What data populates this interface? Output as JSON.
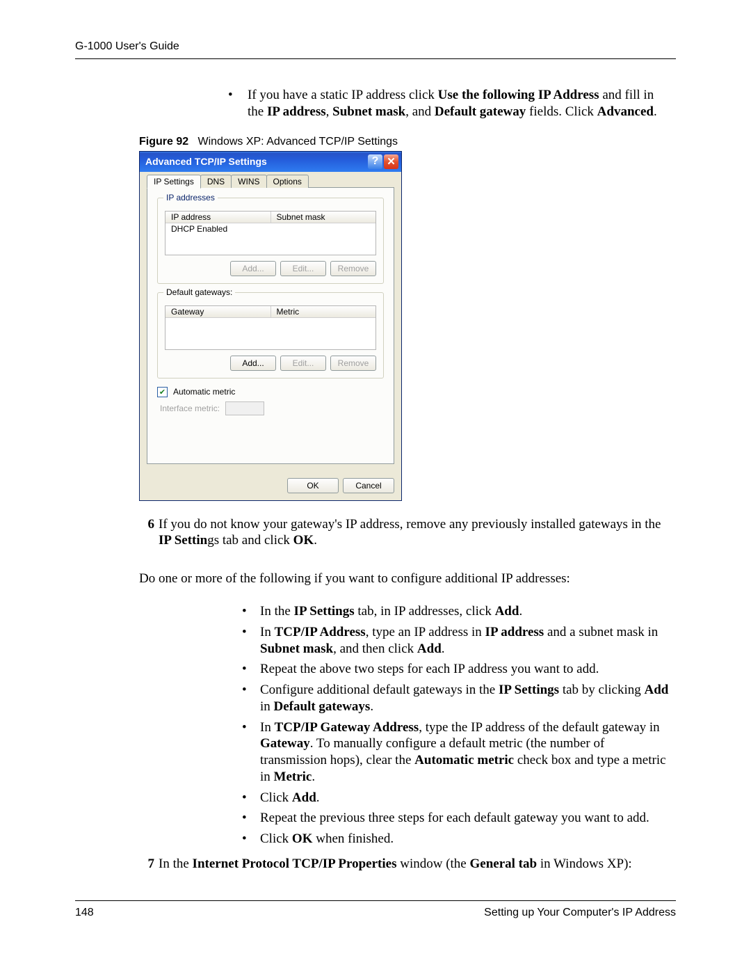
{
  "header": {
    "title": "G-1000 User's Guide"
  },
  "prebullet": {
    "text_parts": [
      "If you have a static IP address click ",
      "Use the following IP Address",
      " and fill in the ",
      "IP address",
      ", ",
      "Subnet mask",
      ", and ",
      "Default gateway",
      " fields. Click ",
      "Advanced",
      "."
    ]
  },
  "figure": {
    "label": "Figure 92",
    "caption": "Windows XP: Advanced TCP/IP Settings"
  },
  "dialog": {
    "title": "Advanced TCP/IP Settings",
    "help_glyph": "?",
    "close_glyph": "✕",
    "tabs": [
      "IP Settings",
      "DNS",
      "WINS",
      "Options"
    ],
    "active_tab": 0,
    "group_ip": {
      "legend": "IP addresses",
      "col1": "IP address",
      "col2": "Subnet mask",
      "row1": "DHCP Enabled",
      "btn_add": "Add...",
      "btn_edit": "Edit...",
      "btn_remove": "Remove"
    },
    "group_gw": {
      "legend": "Default gateways:",
      "col1": "Gateway",
      "col2": "Metric",
      "btn_add": "Add...",
      "btn_edit": "Edit...",
      "btn_remove": "Remove"
    },
    "auto_metric_label": "Automatic metric",
    "auto_metric_checked": true,
    "interface_metric_label": "Interface metric:",
    "ok": "OK",
    "cancel": "Cancel"
  },
  "step6": {
    "num": "6",
    "parts": [
      "If you do not know your gateway's IP address, remove any previously installed gateways in the ",
      "IP Settin",
      "gs tab and click ",
      "OK",
      "."
    ]
  },
  "para1": "Do one or more of the following if you want to configure additional IP addresses:",
  "bullets": [
    {
      "parts": [
        "In the ",
        "IP Settings",
        " tab, in IP addresses, click ",
        "Add",
        "."
      ]
    },
    {
      "parts": [
        "In ",
        "TCP/IP Address",
        ", type an IP address in ",
        "IP address",
        " and a subnet mask in ",
        "Subnet mask",
        ", and then click ",
        "Add",
        "."
      ]
    },
    {
      "parts": [
        "Repeat the above two steps for each IP address you want to add."
      ]
    },
    {
      "parts": [
        "Configure additional default gateways in the ",
        "IP Settings",
        " tab by clicking ",
        "Add",
        " in ",
        "Default gateways",
        "."
      ]
    },
    {
      "parts": [
        "In ",
        "TCP/IP Gateway Address",
        ", type the IP address of the default gateway in ",
        "Gateway",
        ". To manually configure a default metric (the number of transmission hops), clear the ",
        "Automatic metric",
        " check box and type a metric in ",
        "Metric",
        "."
      ]
    },
    {
      "parts": [
        "Click ",
        "Add",
        "."
      ]
    },
    {
      "parts": [
        "Repeat the previous three steps for each default gateway you want to add."
      ]
    },
    {
      "parts": [
        "Click ",
        "OK",
        " when finished."
      ]
    }
  ],
  "step7": {
    "num": "7",
    "parts": [
      "In the ",
      "Internet Protocol TCP/IP Properties",
      " window (the ",
      "General tab",
      " in Windows XP):"
    ]
  },
  "footer": {
    "page_num": "148",
    "section": "Setting up Your Computer's IP Address"
  }
}
